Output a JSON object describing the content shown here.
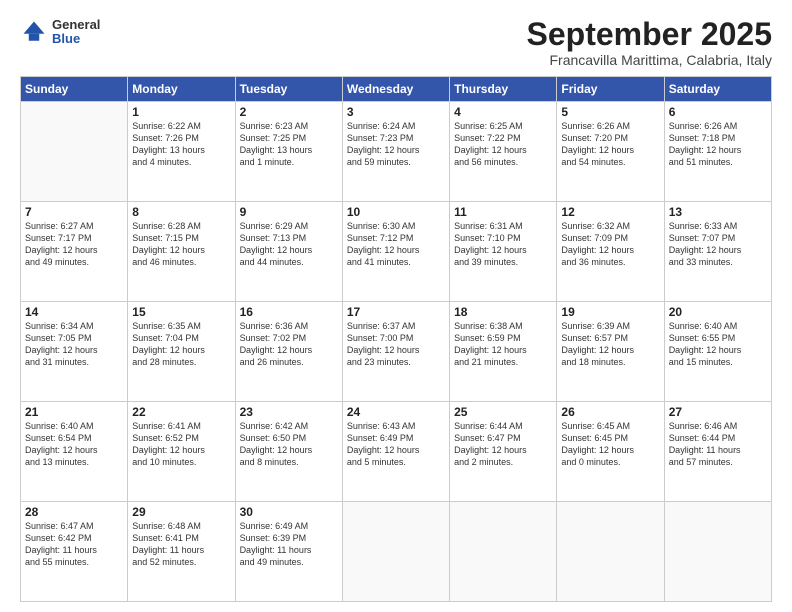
{
  "header": {
    "logo_general": "General",
    "logo_blue": "Blue",
    "month_title": "September 2025",
    "location": "Francavilla Marittima, Calabria, Italy"
  },
  "days_of_week": [
    "Sunday",
    "Monday",
    "Tuesday",
    "Wednesday",
    "Thursday",
    "Friday",
    "Saturday"
  ],
  "weeks": [
    [
      {
        "day": "",
        "info": ""
      },
      {
        "day": "1",
        "info": "Sunrise: 6:22 AM\nSunset: 7:26 PM\nDaylight: 13 hours\nand 4 minutes."
      },
      {
        "day": "2",
        "info": "Sunrise: 6:23 AM\nSunset: 7:25 PM\nDaylight: 13 hours\nand 1 minute."
      },
      {
        "day": "3",
        "info": "Sunrise: 6:24 AM\nSunset: 7:23 PM\nDaylight: 12 hours\nand 59 minutes."
      },
      {
        "day": "4",
        "info": "Sunrise: 6:25 AM\nSunset: 7:22 PM\nDaylight: 12 hours\nand 56 minutes."
      },
      {
        "day": "5",
        "info": "Sunrise: 6:26 AM\nSunset: 7:20 PM\nDaylight: 12 hours\nand 54 minutes."
      },
      {
        "day": "6",
        "info": "Sunrise: 6:26 AM\nSunset: 7:18 PM\nDaylight: 12 hours\nand 51 minutes."
      }
    ],
    [
      {
        "day": "7",
        "info": "Sunrise: 6:27 AM\nSunset: 7:17 PM\nDaylight: 12 hours\nand 49 minutes."
      },
      {
        "day": "8",
        "info": "Sunrise: 6:28 AM\nSunset: 7:15 PM\nDaylight: 12 hours\nand 46 minutes."
      },
      {
        "day": "9",
        "info": "Sunrise: 6:29 AM\nSunset: 7:13 PM\nDaylight: 12 hours\nand 44 minutes."
      },
      {
        "day": "10",
        "info": "Sunrise: 6:30 AM\nSunset: 7:12 PM\nDaylight: 12 hours\nand 41 minutes."
      },
      {
        "day": "11",
        "info": "Sunrise: 6:31 AM\nSunset: 7:10 PM\nDaylight: 12 hours\nand 39 minutes."
      },
      {
        "day": "12",
        "info": "Sunrise: 6:32 AM\nSunset: 7:09 PM\nDaylight: 12 hours\nand 36 minutes."
      },
      {
        "day": "13",
        "info": "Sunrise: 6:33 AM\nSunset: 7:07 PM\nDaylight: 12 hours\nand 33 minutes."
      }
    ],
    [
      {
        "day": "14",
        "info": "Sunrise: 6:34 AM\nSunset: 7:05 PM\nDaylight: 12 hours\nand 31 minutes."
      },
      {
        "day": "15",
        "info": "Sunrise: 6:35 AM\nSunset: 7:04 PM\nDaylight: 12 hours\nand 28 minutes."
      },
      {
        "day": "16",
        "info": "Sunrise: 6:36 AM\nSunset: 7:02 PM\nDaylight: 12 hours\nand 26 minutes."
      },
      {
        "day": "17",
        "info": "Sunrise: 6:37 AM\nSunset: 7:00 PM\nDaylight: 12 hours\nand 23 minutes."
      },
      {
        "day": "18",
        "info": "Sunrise: 6:38 AM\nSunset: 6:59 PM\nDaylight: 12 hours\nand 21 minutes."
      },
      {
        "day": "19",
        "info": "Sunrise: 6:39 AM\nSunset: 6:57 PM\nDaylight: 12 hours\nand 18 minutes."
      },
      {
        "day": "20",
        "info": "Sunrise: 6:40 AM\nSunset: 6:55 PM\nDaylight: 12 hours\nand 15 minutes."
      }
    ],
    [
      {
        "day": "21",
        "info": "Sunrise: 6:40 AM\nSunset: 6:54 PM\nDaylight: 12 hours\nand 13 minutes."
      },
      {
        "day": "22",
        "info": "Sunrise: 6:41 AM\nSunset: 6:52 PM\nDaylight: 12 hours\nand 10 minutes."
      },
      {
        "day": "23",
        "info": "Sunrise: 6:42 AM\nSunset: 6:50 PM\nDaylight: 12 hours\nand 8 minutes."
      },
      {
        "day": "24",
        "info": "Sunrise: 6:43 AM\nSunset: 6:49 PM\nDaylight: 12 hours\nand 5 minutes."
      },
      {
        "day": "25",
        "info": "Sunrise: 6:44 AM\nSunset: 6:47 PM\nDaylight: 12 hours\nand 2 minutes."
      },
      {
        "day": "26",
        "info": "Sunrise: 6:45 AM\nSunset: 6:45 PM\nDaylight: 12 hours\nand 0 minutes."
      },
      {
        "day": "27",
        "info": "Sunrise: 6:46 AM\nSunset: 6:44 PM\nDaylight: 11 hours\nand 57 minutes."
      }
    ],
    [
      {
        "day": "28",
        "info": "Sunrise: 6:47 AM\nSunset: 6:42 PM\nDaylight: 11 hours\nand 55 minutes."
      },
      {
        "day": "29",
        "info": "Sunrise: 6:48 AM\nSunset: 6:41 PM\nDaylight: 11 hours\nand 52 minutes."
      },
      {
        "day": "30",
        "info": "Sunrise: 6:49 AM\nSunset: 6:39 PM\nDaylight: 11 hours\nand 49 minutes."
      },
      {
        "day": "",
        "info": ""
      },
      {
        "day": "",
        "info": ""
      },
      {
        "day": "",
        "info": ""
      },
      {
        "day": "",
        "info": ""
      }
    ]
  ]
}
